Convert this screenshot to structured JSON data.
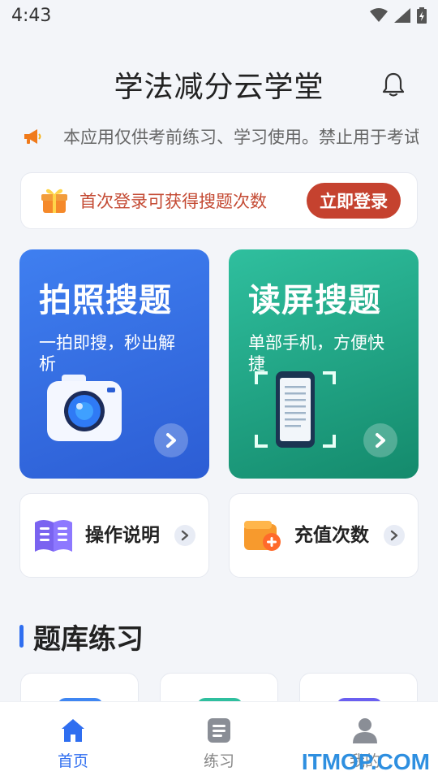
{
  "status_bar": {
    "time": "4:43"
  },
  "header": {
    "title": "学法减分云学堂"
  },
  "notice": {
    "text": "本应用仅供考前练习、学习使用。禁止用于考试作弊"
  },
  "login_banner": {
    "text": "首次登录可获得搜题次数",
    "button_label": "立即登录"
  },
  "feature_cards": [
    {
      "title": "拍照搜题",
      "subtitle": "一拍即搜，秒出解析"
    },
    {
      "title": "读屏搜题",
      "subtitle": "单部手机，方便快捷"
    }
  ],
  "tiles": [
    {
      "label": "操作说明"
    },
    {
      "label": "充值次数"
    }
  ],
  "section": {
    "title": "题库练习"
  },
  "tabbar": {
    "items": [
      {
        "label": "首页",
        "icon": "home-icon",
        "active": true
      },
      {
        "label": "练习",
        "icon": "practice-icon",
        "active": false
      },
      {
        "label": "我的",
        "icon": "profile-icon",
        "active": false
      }
    ]
  },
  "watermark": {
    "text": "ITMOP.COM"
  },
  "colors": {
    "accent": "#2f6ef0",
    "login_red": "#c5422f",
    "photo_card": "#3a72e8",
    "screen_card": "#23a887"
  }
}
